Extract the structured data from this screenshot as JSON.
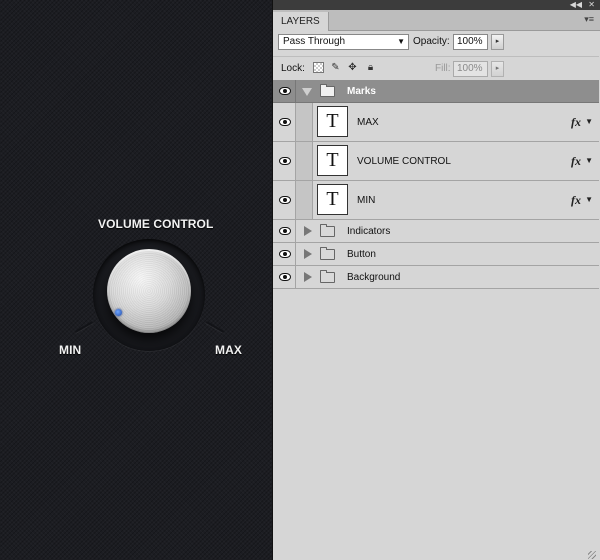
{
  "canvas": {
    "title": "VOLUME CONTROL",
    "min_label": "MIN",
    "max_label": "MAX"
  },
  "panel": {
    "tab_label": "LAYERS",
    "blend_mode": "Pass Through",
    "opacity_label": "Opacity:",
    "opacity_value": "100%",
    "lock_label": "Lock:",
    "fill_label": "Fill:",
    "fill_value": "100%"
  },
  "layers": {
    "group": {
      "name": "Marks"
    },
    "text_layers": [
      {
        "name": "MAX",
        "thumb": "T",
        "fx": "fx"
      },
      {
        "name": "VOLUME CONTROL",
        "thumb": "T",
        "fx": "fx"
      },
      {
        "name": "MIN",
        "thumb": "T",
        "fx": "fx"
      }
    ],
    "collapsed_groups": [
      {
        "name": "Indicators"
      },
      {
        "name": "Button"
      },
      {
        "name": "Background"
      }
    ]
  },
  "colors": {
    "knob_indicator": "#2f5fc4",
    "panel_bg": "#d6d6d6",
    "group_header_bg": "#8e8e8e"
  },
  "icons": [
    "eye-icon",
    "folder-icon",
    "disclosure-triangle-icon",
    "fx-icon",
    "lock-icon",
    "move-icon",
    "brush-icon",
    "transparency-lock-icon",
    "panel-menu-icon"
  ]
}
